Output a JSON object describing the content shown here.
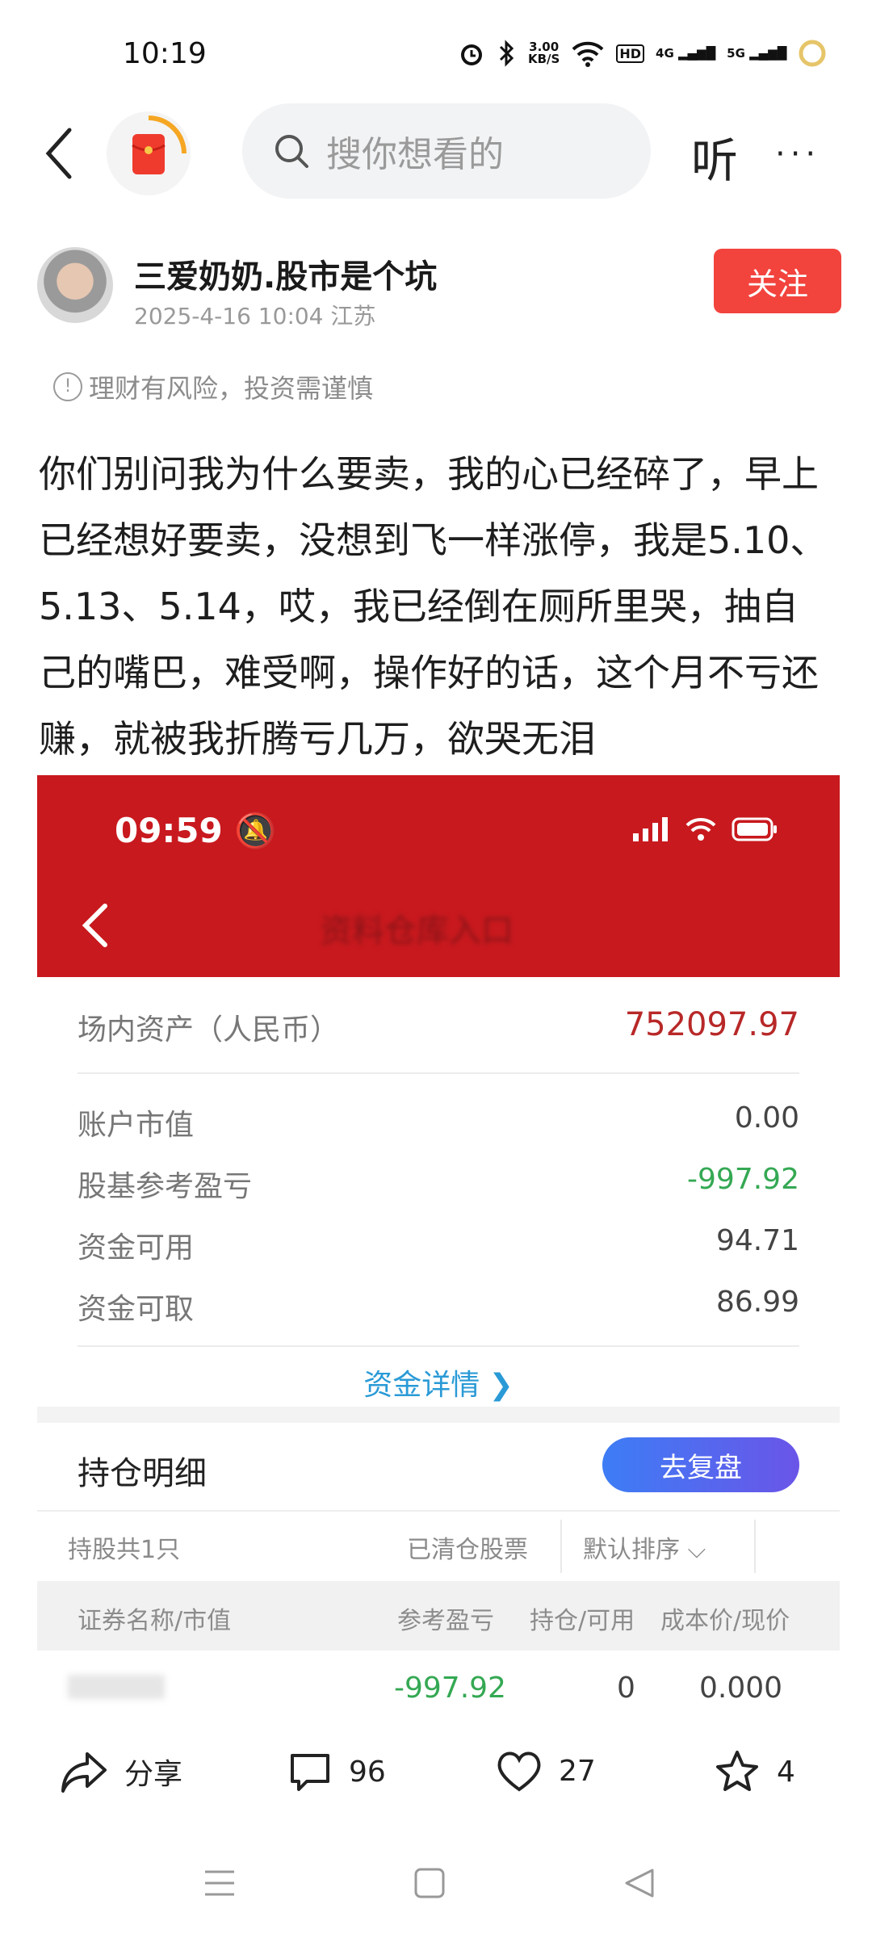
{
  "status_bar": {
    "time": "10:19",
    "net_speed_value": "3.00",
    "net_speed_unit": "KB/S",
    "hd": "HD",
    "sig1": "4G",
    "sig2": "5G"
  },
  "top_bar": {
    "search_placeholder": "搜你想看的",
    "listen": "听",
    "more": "···"
  },
  "author": {
    "name": "三爱奶奶.股市是个坑",
    "meta": "2025-4-16 10:04 江苏",
    "follow": "关注"
  },
  "risk_notice": "理财有风险，投资需谨慎",
  "post_text": "你们别问我为什么要卖，我的心已经碎了，早上已经想好要卖，没想到飞一样涨停，我是5.10、5.13、5.14，哎，我已经倒在厕所里哭，抽自己的嘴巴，难受啊，操作好的话，这个月不亏还赚，就被我折腾亏几万，欲哭无泪",
  "screenshot": {
    "time": "09:59",
    "title_blurred": "资料仓库入口",
    "assets_label": "场内资产（人民币）",
    "assets_value": "752097.97",
    "rows": [
      {
        "label": "账户市值",
        "value": "0.00"
      },
      {
        "label": "股基参考盈亏",
        "value": "-997.92"
      },
      {
        "label": "资金可用",
        "value": "94.71"
      },
      {
        "label": "资金可取",
        "value": "86.99"
      }
    ],
    "detail_link": "资金详情 ❯",
    "holdings_title": "持仓明细",
    "review_button": "去复盘",
    "filter": {
      "count": "持股共1只",
      "cleared": "已清仓股票",
      "sort": "默认排序 ⌵"
    },
    "columns": {
      "name": "证券名称/市值",
      "pnl": "参考盈亏",
      "pos": "持仓/可用",
      "cost": "成本价/现价"
    },
    "holding": {
      "pnl": "-997.92",
      "pos": "0",
      "cost": "0.000"
    },
    "colors": {
      "header": "#c8191e",
      "loss": "#34a853",
      "assets": "#b82828"
    }
  },
  "actions": {
    "share": "分享",
    "comments": "96",
    "likes": "27",
    "favorites": "4"
  }
}
